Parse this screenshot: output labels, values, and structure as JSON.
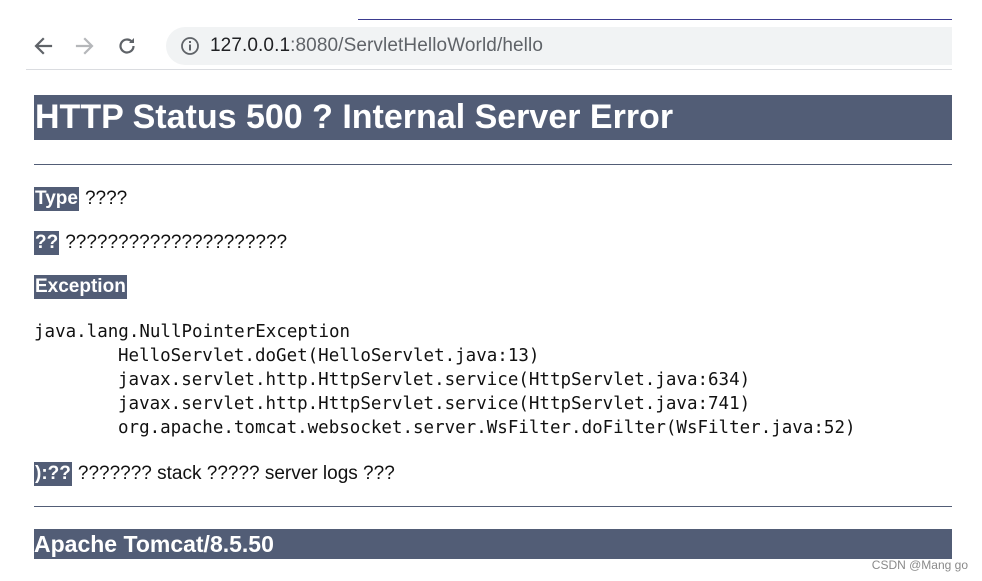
{
  "browser": {
    "url_host": "127.0.0.1",
    "url_rest": ":8080/ServletHelloWorld/hello",
    "icons": {
      "back": "arrow-left",
      "forward": "arrow-right",
      "reload": "reload",
      "site_info": "info-circle"
    }
  },
  "error_page": {
    "title": "HTTP Status 500 ? Internal Server Error",
    "type_label": "Type",
    "type_value": "????",
    "message_label": "??",
    "message_value": "?????????????????????",
    "exception_label": "Exception",
    "stack_trace": {
      "exception": "java.lang.NullPointerException",
      "frames": [
        "HelloServlet.doGet(HelloServlet.java:13)",
        "javax.servlet.http.HttpServlet.service(HttpServlet.java:634)",
        "javax.servlet.http.HttpServlet.service(HttpServlet.java:741)",
        "org.apache.tomcat.websocket.server.WsFilter.doFilter(WsFilter.java:52)"
      ]
    },
    "note_label": "):??",
    "note_value": "??????? stack ????? server logs ???",
    "footer": "Apache Tomcat/8.5.50"
  },
  "colors": {
    "accent": "#525d76",
    "address_bar_bg": "#f1f3f4"
  },
  "watermark": "CSDN @Mang go"
}
